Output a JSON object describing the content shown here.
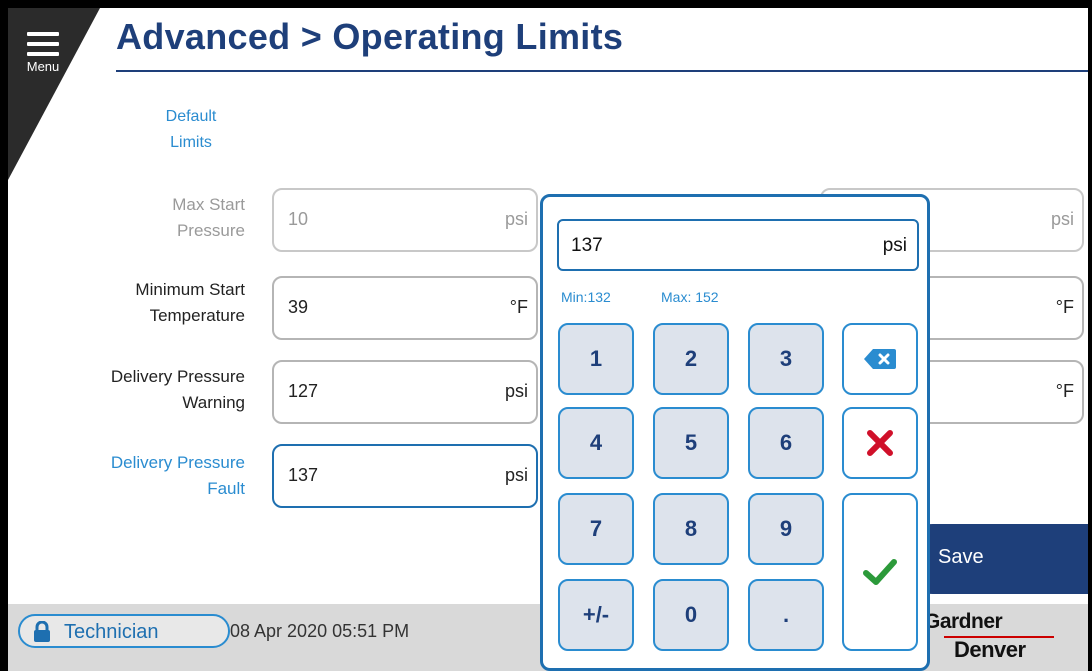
{
  "header": {
    "menu_label": "Menu",
    "title": "Advanced > Operating Limits"
  },
  "default_limits": {
    "line1": "Default",
    "line2": "Limits"
  },
  "rows": [
    {
      "label_line1": "Max Start",
      "label_line2": "Pressure",
      "value": "10",
      "unit": "psi",
      "state": "disabled"
    },
    {
      "label_line1": "Minimum Start",
      "label_line2": "Temperature",
      "value": "39",
      "unit": "°F",
      "state": "normal"
    },
    {
      "label_line1": "Delivery Pressure",
      "label_line2": "Warning",
      "value": "127",
      "unit": "psi",
      "state": "normal"
    },
    {
      "label_line1": "Delivery Pressure",
      "label_line2": "Fault",
      "value": "137",
      "unit": "psi",
      "state": "active"
    }
  ],
  "right_fields": [
    {
      "unit": "psi",
      "state": "disabled"
    },
    {
      "unit": "°F",
      "state": "normal"
    },
    {
      "unit": "°F",
      "state": "normal"
    }
  ],
  "save_label": "Save",
  "keypad": {
    "display_value": "137",
    "display_unit": "psi",
    "min_label": "Min:132",
    "max_label": "Max:  152",
    "keys": [
      "1",
      "2",
      "3",
      "4",
      "5",
      "6",
      "7",
      "8",
      "9",
      "+/-",
      "0",
      "."
    ],
    "backspace_icon": "backspace-icon",
    "cancel_icon": "close-icon",
    "confirm_icon": "checkmark-icon"
  },
  "status_bar": {
    "role": "Technician",
    "datetime": "08 Apr 2020  05:51 PM",
    "logo_line1": "Gardner",
    "logo_line2": "Denver"
  },
  "colors": {
    "brand_navy": "#1e3f7a",
    "accent_blue": "#2a8cd0",
    "cancel_red": "#d0102a",
    "confirm_green": "#2c9a3a"
  }
}
